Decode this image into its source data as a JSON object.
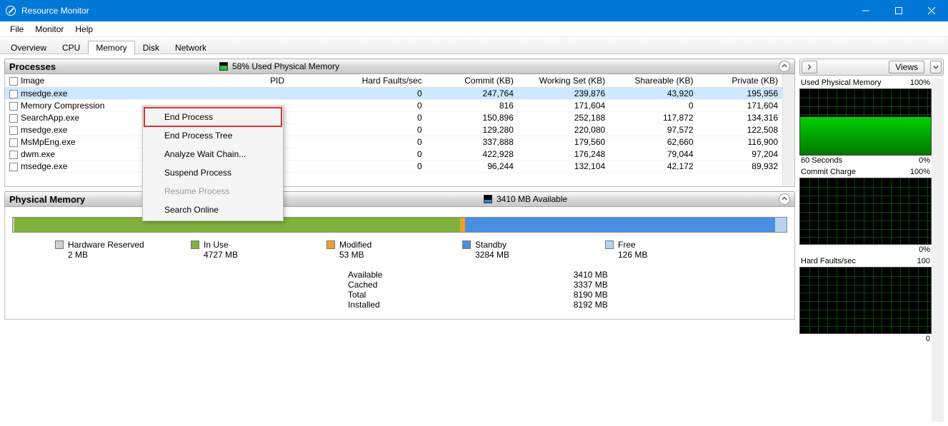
{
  "window": {
    "title": "Resource Monitor"
  },
  "menubar": [
    "File",
    "Monitor",
    "Help"
  ],
  "tabs": [
    "Overview",
    "CPU",
    "Memory",
    "Disk",
    "Network"
  ],
  "active_tab": "Memory",
  "processes": {
    "title": "Processes",
    "subtitle": "58% Used Physical Memory",
    "indicator_color": "#2fbf2f",
    "columns": [
      "Image",
      "PID",
      "Hard Faults/sec",
      "Commit (KB)",
      "Working Set (KB)",
      "Shareable (KB)",
      "Private (KB)"
    ],
    "rows": [
      {
        "image": "msedge.exe",
        "pid": "",
        "hf": "0",
        "commit": "247,764",
        "ws": "239,876",
        "sh": "43,920",
        "pr": "195,956",
        "selected": true
      },
      {
        "image": "Memory Compression",
        "pid": "",
        "hf": "0",
        "commit": "816",
        "ws": "171,604",
        "sh": "0",
        "pr": "171,604"
      },
      {
        "image": "SearchApp.exe",
        "pid": "",
        "hf": "0",
        "commit": "150,896",
        "ws": "252,188",
        "sh": "117,872",
        "pr": "134,316"
      },
      {
        "image": "msedge.exe",
        "pid": "",
        "hf": "0",
        "commit": "129,280",
        "ws": "220,080",
        "sh": "97,572",
        "pr": "122,508"
      },
      {
        "image": "MsMpEng.exe",
        "pid": "",
        "hf": "0",
        "commit": "337,888",
        "ws": "179,560",
        "sh": "62,660",
        "pr": "116,900"
      },
      {
        "image": "dwm.exe",
        "pid": "",
        "hf": "0",
        "commit": "422,928",
        "ws": "176,248",
        "sh": "79,044",
        "pr": "97,204"
      },
      {
        "image": "msedge.exe",
        "pid": "",
        "hf": "0",
        "commit": "96,244",
        "ws": "132,104",
        "sh": "42,172",
        "pr": "89,932"
      }
    ]
  },
  "context_menu": {
    "items": [
      {
        "label": "End Process",
        "highlighted": true
      },
      {
        "label": "End Process Tree"
      },
      {
        "label": "Analyze Wait Chain..."
      },
      {
        "label": "Suspend Process"
      },
      {
        "label": "Resume Process",
        "disabled": true
      },
      {
        "label": "Search Online"
      }
    ]
  },
  "physical_memory": {
    "title": "Physical Memory",
    "subtitle": "3410 MB Available",
    "indicator_color": "#3d7edb",
    "bar": [
      {
        "label": "Hardware Reserved",
        "value": "2 MB",
        "color": "#d0d0d0",
        "pct": 0.2
      },
      {
        "label": "In Use",
        "value": "4727 MB",
        "color": "#7fb23a",
        "pct": 57.7
      },
      {
        "label": "Modified",
        "value": "53 MB",
        "color": "#f0a028",
        "pct": 0.7
      },
      {
        "label": "Standby",
        "value": "3284 MB",
        "color": "#4a90e2",
        "pct": 40.1
      },
      {
        "label": "Free",
        "value": "126 MB",
        "color": "#b8d3f0",
        "pct": 1.5
      }
    ],
    "stats": [
      {
        "k": "Available",
        "v": "3410 MB"
      },
      {
        "k": "Cached",
        "v": "3337 MB"
      },
      {
        "k": "Total",
        "v": "8190 MB"
      },
      {
        "k": "Installed",
        "v": "8192 MB"
      }
    ]
  },
  "sidebar": {
    "views_label": "Views",
    "graphs": [
      {
        "title": "Used Physical Memory",
        "top_right": "100%",
        "foot_left": "60 Seconds",
        "foot_right": "0%",
        "fill_pct": 58
      },
      {
        "title": "Commit Charge",
        "top_right": "100%",
        "foot_left": "",
        "foot_right": "0%",
        "fill_pct": 0
      },
      {
        "title": "Hard Faults/sec",
        "top_right": "100",
        "foot_left": "",
        "foot_right": "0",
        "fill_pct": 0
      }
    ]
  },
  "chart_data": {
    "type": "bar",
    "title": "Physical Memory breakdown (MB)",
    "categories": [
      "Hardware Reserved",
      "In Use",
      "Modified",
      "Standby",
      "Free"
    ],
    "values": [
      2,
      4727,
      53,
      3284,
      126
    ],
    "available_mb": 3410,
    "cached_mb": 3337,
    "total_mb": 8190,
    "installed_mb": 8192,
    "used_physical_memory_pct": 58
  }
}
